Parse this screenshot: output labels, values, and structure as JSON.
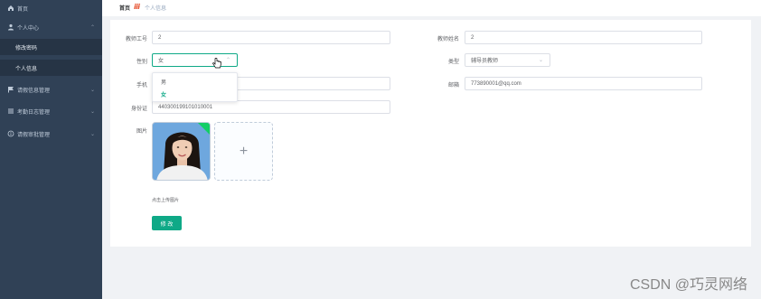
{
  "sidebar": {
    "items": [
      {
        "label": "首页",
        "icon": "home-icon"
      },
      {
        "label": "个人中心",
        "icon": "user-icon"
      },
      {
        "label": "修改密码"
      },
      {
        "label": "个人信息"
      },
      {
        "label": "请假信息管理",
        "icon": "flag-icon"
      },
      {
        "label": "考勤日志管理",
        "icon": "list-icon"
      },
      {
        "label": "请假审批管理",
        "icon": "info-icon"
      }
    ]
  },
  "breadcrumb": {
    "home": "首页",
    "separator": "ⅲ",
    "current": "个人信息"
  },
  "form": {
    "teacher_id_label": "教师工号",
    "teacher_id_value": "2",
    "teacher_name_label": "教师姓名",
    "teacher_name_value": "2",
    "gender_label": "性别",
    "gender_value": "女",
    "gender_options": [
      "男",
      "女"
    ],
    "type_label": "类型",
    "type_value": "辅导员教师",
    "phone_label": "手机",
    "email_label": "邮箱",
    "email_value": "773890001@qq.com",
    "idcard_label": "身份证",
    "idcard_value": "440300199101010001",
    "photo_label": "图片",
    "upload_plus": "+",
    "upload_tip": "点击上传图片",
    "submit_label": "修 改"
  },
  "watermark": "CSDN @巧灵网络",
  "colors": {
    "sidebar_bg": "#304156",
    "accent": "#0fa987"
  }
}
